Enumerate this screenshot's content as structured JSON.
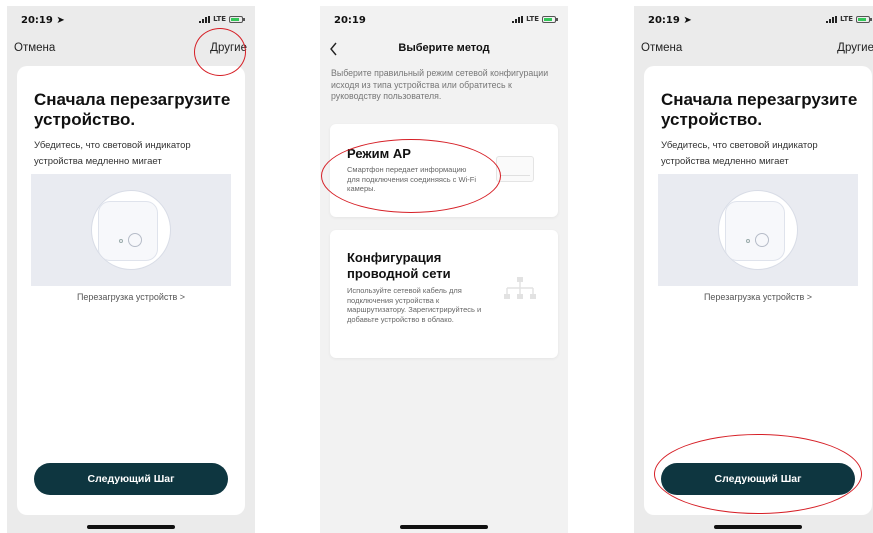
{
  "status": {
    "time_p1": "20:19",
    "time_p2": "20:19",
    "time_p3": "20:19",
    "network": "LTE"
  },
  "reboot": {
    "cancel": "Отмена",
    "other": "Другие",
    "title": "Сначала перезагрузите устройство.",
    "description": "Убедитесь, что световой индикатор устройства медленно мигает",
    "reboot_link": "Перезагрузка устройств >",
    "next_button": "Следующий Шаг"
  },
  "method": {
    "title": "Выберите метод",
    "intro": "Выберите правильный режим сетевой конфигурации исходя из типа устройства или обратитесь к руководству пользователя.",
    "options": [
      {
        "title": "Режим AP",
        "description": "Смартфон передает информацию для подключения соединяясь с Wi-Fi камеры."
      },
      {
        "title": "Конфигурация проводной сети",
        "description": "Используйте сетевой кабель для подключения устройства к маршрутизатору. Зарегистрируйтесь и добавьте устройство в облако."
      }
    ]
  },
  "colors": {
    "button_bg": "#0e3640",
    "highlight_ring": "#d61f26",
    "illustration_bg": "#e9ebf1"
  },
  "icons": [
    "location-arrow-icon",
    "signal-icon",
    "battery-icon",
    "chevron-left-icon",
    "power-icon",
    "network-topology-icon"
  ]
}
